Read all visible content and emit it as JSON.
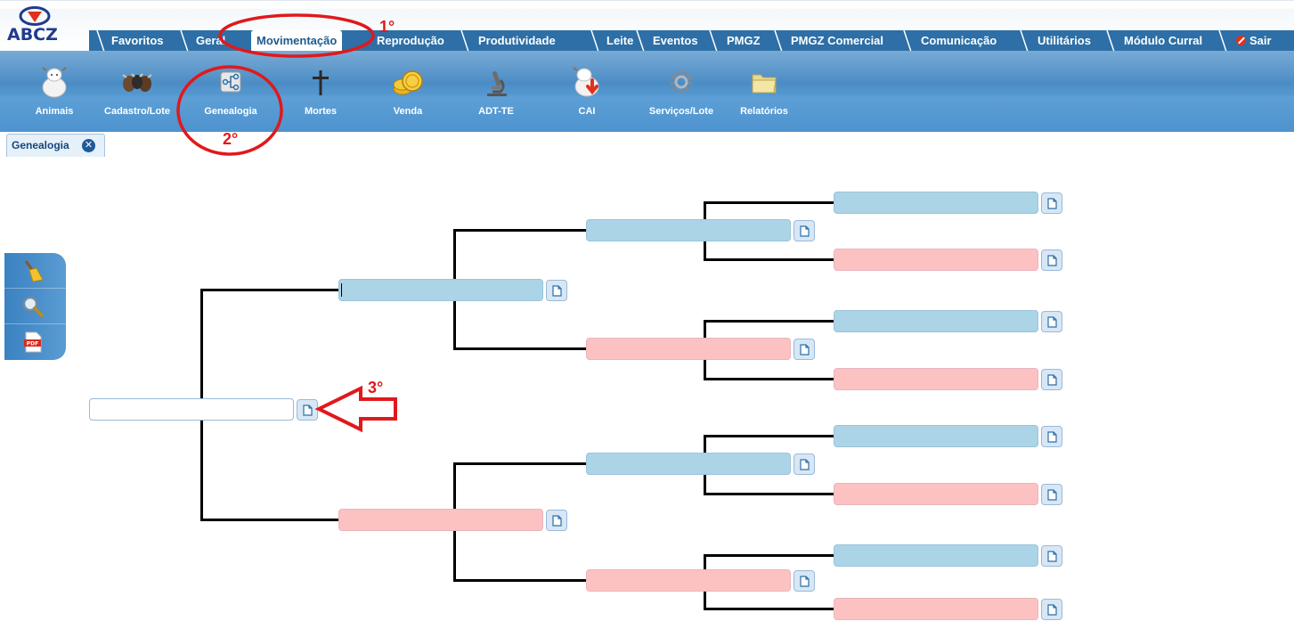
{
  "brand": {
    "logo_text": "ABCZ"
  },
  "tabs": [
    {
      "label": "Favoritos"
    },
    {
      "label": "Geral"
    },
    {
      "label": "Movimentação",
      "active": true
    },
    {
      "label": "Reprodução"
    },
    {
      "label": "Produtividade"
    },
    {
      "label": "Leite"
    },
    {
      "label": "Eventos"
    },
    {
      "label": "PMGZ"
    },
    {
      "label": "PMGZ Comercial"
    },
    {
      "label": "Comunicação"
    },
    {
      "label": "Utilitários"
    },
    {
      "label": "Módulo Curral"
    },
    {
      "label": "Sair"
    }
  ],
  "toolbar": {
    "items": [
      {
        "label": "Animais",
        "icon": "cow-icon"
      },
      {
        "label": "Cadastro/Lote",
        "icon": "cattle-group-icon"
      },
      {
        "label": "Genealogia",
        "icon": "genealogy-icon"
      },
      {
        "label": "Mortes",
        "icon": "cross-icon"
      },
      {
        "label": "Venda",
        "icon": "coins-icon"
      },
      {
        "label": "ADT-TE",
        "icon": "microscope-icon"
      },
      {
        "label": "CAI",
        "icon": "cow-download-icon"
      },
      {
        "label": "Serviços/Lote",
        "icon": "gears-icon"
      },
      {
        "label": "Relatórios",
        "icon": "folder-icon"
      }
    ]
  },
  "doc_tab": {
    "label": "Genealogia"
  },
  "sidebar": {
    "buttons": [
      {
        "icon": "broom-icon"
      },
      {
        "icon": "magnifier-icon"
      },
      {
        "icon": "pdf-icon"
      }
    ]
  },
  "annotations": {
    "step1": "1°",
    "step2": "2°",
    "step3": "3°"
  },
  "colors": {
    "accent": "#2d6fa6",
    "male_box": "#abd4e6",
    "female_box": "#fcc2c2",
    "annotation": "#e0191c"
  }
}
